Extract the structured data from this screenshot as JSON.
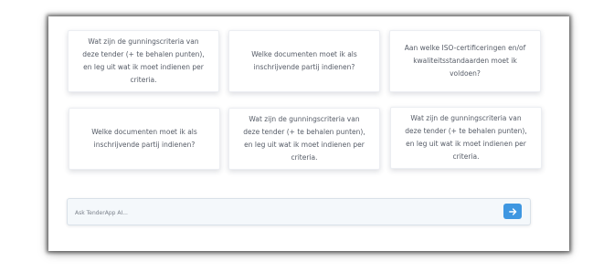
{
  "suggestions": [
    {
      "text": "Wat zijn de gunningscriteria van deze tender (+ te behalen punten), en leg uit wat ik moet indienen per criteria."
    },
    {
      "text": "Welke documenten moet ik als inschrijvende partij indienen?"
    },
    {
      "text": "Aan welke ISO-certificeringen en/of kwaliteitsstandaarden moet ik voldoen?"
    },
    {
      "text": "Welke documenten moet ik als inschrijvende partij indienen?"
    },
    {
      "text": "Wat zijn de gunningscriteria van deze tender (+ te behalen punten), en leg uit wat ik moet indienen per criteria."
    },
    {
      "text": "Wat zijn de gunningscriteria van deze tender (+ te behalen punten), en leg uit wat ik moet indienen per criteria."
    }
  ],
  "ask": {
    "placeholder": "Ask TenderApp AI...",
    "value": ""
  },
  "send_button": {
    "icon": "arrow-right-icon",
    "color": "#3f97e1"
  }
}
